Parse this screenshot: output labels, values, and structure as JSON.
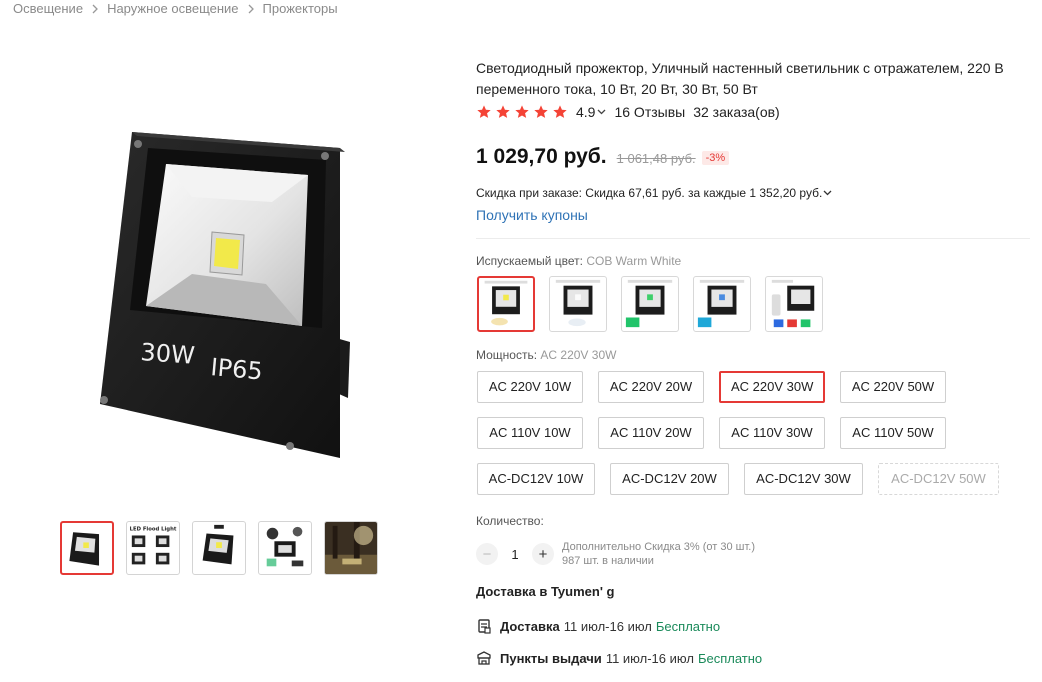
{
  "breadcrumb": [
    "Освещение",
    "Наружное освещение",
    "Прожекторы"
  ],
  "product": {
    "title": "Светодиодный прожектор, Уличный настенный светильник с отражателем, 220 В переменного тока, 10 Вт, 20 Вт, 30 Вт, 50 Вт",
    "image_text": {
      "watt": "30W",
      "ip": "IP65"
    },
    "thumb_text": "LED Flood Light"
  },
  "rating": {
    "value": "4.9",
    "stars": 5,
    "reviews": "16 Отзывы",
    "orders": "32 заказа(ов)"
  },
  "price": {
    "current": "1 029,70 руб.",
    "old": "1 061,48 руб.",
    "discount": "-3%"
  },
  "order_discount": "Скидка при заказе: Скидка 67,61 руб. за каждые 1 352,20 руб.",
  "coupons": "Получить купоны",
  "color": {
    "label": "Испускаемый цвет:",
    "selected": "COB Warm White",
    "swatches": [
      "COB Warm White",
      "COB Cold White",
      "COB Green",
      "COB Blue",
      "RGB"
    ]
  },
  "power": {
    "label": "Мощность:",
    "selected": "AC 220V 30W",
    "rows": [
      [
        "AC 220V 10W",
        "AC 220V 20W",
        "AC 220V 30W",
        "AC 220V 50W"
      ],
      [
        "AC 110V 10W",
        "AC 110V 20W",
        "AC 110V 30W",
        "AC 110V 50W"
      ],
      [
        "AC-DC12V 10W",
        "AC-DC12V 20W",
        "AC-DC12V 30W",
        "AC-DC12V 50W"
      ]
    ]
  },
  "quantity": {
    "label": "Количество:",
    "value": "1",
    "extra_discount": "Дополнительно Скидка 3% (от 30 шт.)",
    "stock": "987 шт. в наличии"
  },
  "delivery": {
    "title": "Доставка в Tyumen' g",
    "options": [
      {
        "name": "Доставка",
        "dates": "11 июл-16 июл",
        "price": "Бесплатно"
      },
      {
        "name": "Пункты выдачи",
        "dates": "11 июл-16 июл",
        "price": "Бесплатно"
      }
    ]
  },
  "colors": {
    "accent": "#e53935",
    "link": "#2f73b6",
    "free": "#1a8a5a",
    "star": "#f44336"
  }
}
